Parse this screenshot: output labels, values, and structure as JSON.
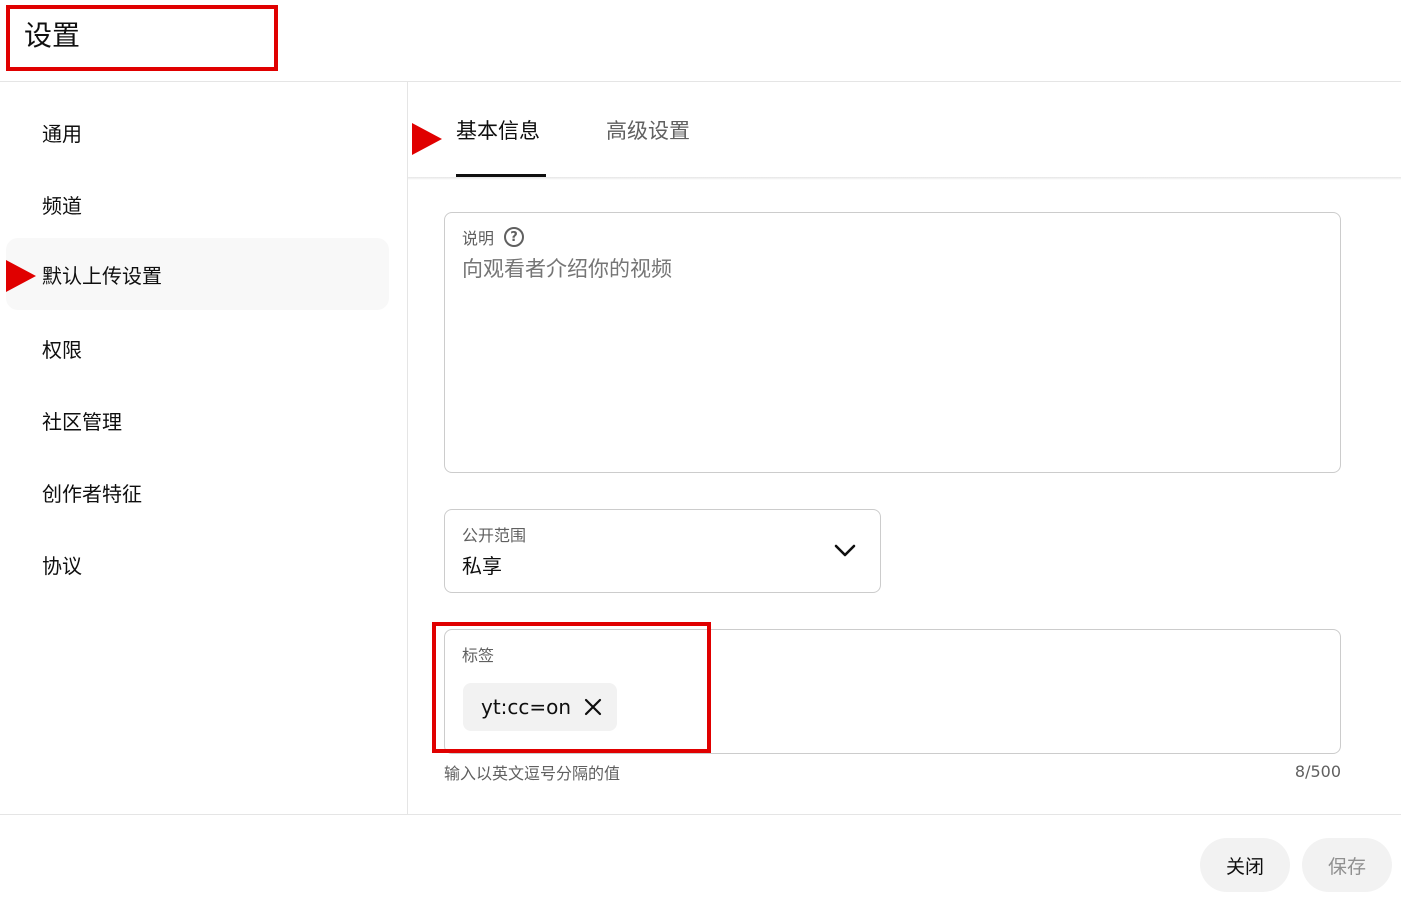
{
  "header": {
    "title": "设置"
  },
  "sidebar": {
    "items": [
      {
        "label": "通用",
        "active": false
      },
      {
        "label": "频道",
        "active": false
      },
      {
        "label": "默认上传设置",
        "active": true
      },
      {
        "label": "权限",
        "active": false
      },
      {
        "label": "社区管理",
        "active": false
      },
      {
        "label": "创作者特征",
        "active": false
      },
      {
        "label": "协议",
        "active": false
      }
    ]
  },
  "tabs": [
    {
      "label": "基本信息",
      "active": true
    },
    {
      "label": "高级设置",
      "active": false
    }
  ],
  "description": {
    "label": "说明",
    "help_icon": "?",
    "placeholder": "向观看者介绍你的视频",
    "value": ""
  },
  "visibility": {
    "label": "公开范围",
    "value": "私享"
  },
  "tags": {
    "label": "标签",
    "chips": [
      "yt:cc=on"
    ],
    "helper": "输入以英文逗号分隔的值",
    "count": "8/500"
  },
  "footer": {
    "close_label": "关闭",
    "save_label": "保存"
  },
  "colors": {
    "annotation": "#e00000",
    "active_bg": "#f8f8f8",
    "chip_bg": "#f2f2f2",
    "muted_text": "#606060"
  }
}
